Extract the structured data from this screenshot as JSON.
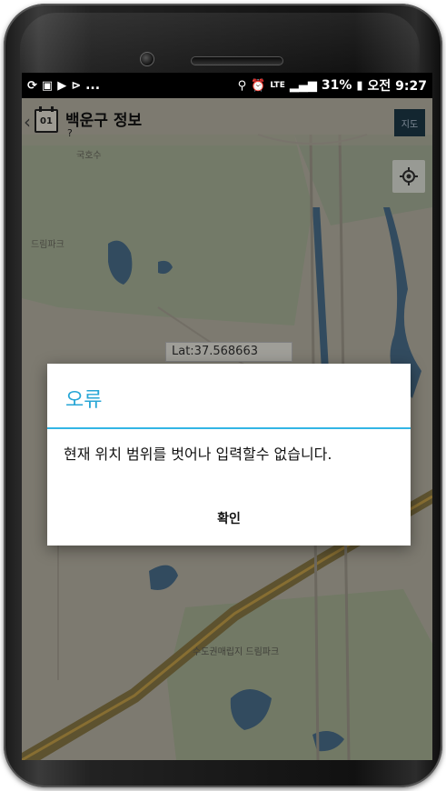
{
  "status_bar": {
    "left_icons": [
      "sync-icon",
      "gallery-icon",
      "youtube-icon",
      "play-store-icon"
    ],
    "left_more": "...",
    "right_icons": [
      "location-icon",
      "alarm-icon",
      "lte-icon",
      "signal-icon"
    ],
    "battery": "31%",
    "time": "오전 9:27"
  },
  "app_bar": {
    "title": "백운구 정보",
    "subtitle": "?",
    "right_button": "지도"
  },
  "map": {
    "place_label_1": "국호수",
    "place_label_2": "드림파크",
    "lat_label": "Lat:37.568663",
    "place_label_3": "수도권매립지\n드림파크",
    "colors": {
      "land": "#b9b4a6",
      "green": "#a9b59a",
      "water": "#4b6f8c",
      "road": "#8a7a46"
    }
  },
  "dialog": {
    "title": "오류",
    "message": "현재 위치 범위를 벗어나 입력할수 없습니다.",
    "ok_label": "확인",
    "accent": "#33b5e5"
  }
}
